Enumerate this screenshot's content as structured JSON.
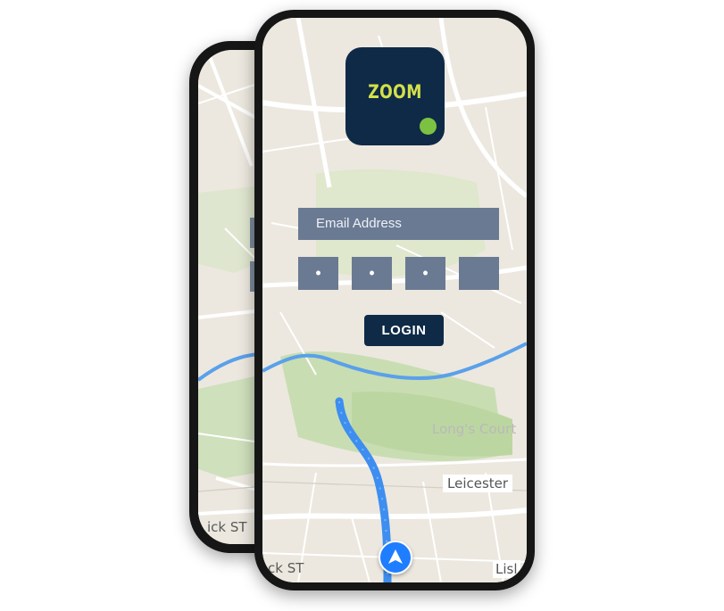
{
  "app": {
    "logo_text": "ZOOM"
  },
  "login_form": {
    "email_placeholder": "Email Address",
    "pin_digits": [
      "•",
      "•",
      "•",
      ""
    ],
    "login_label": "LOGIN"
  },
  "map": {
    "labels": {
      "longs_court": "Long's Court",
      "leicester": "Leicester",
      "street_front": "ck ST",
      "street_front_right": "Lisl",
      "street_back": "ick ST"
    }
  },
  "icons": {
    "navigation": "navigation-arrow-icon",
    "status": "status-dot-icon"
  },
  "colors": {
    "brand_navy": "#0e2a47",
    "logo_text": "#d4e04a",
    "status_dot": "#7dc142",
    "input_fill": "#6b7a93",
    "route_blue": "#3d8ef0",
    "river_blue": "#5aa0ea",
    "park_green": "#c9ddb3"
  }
}
